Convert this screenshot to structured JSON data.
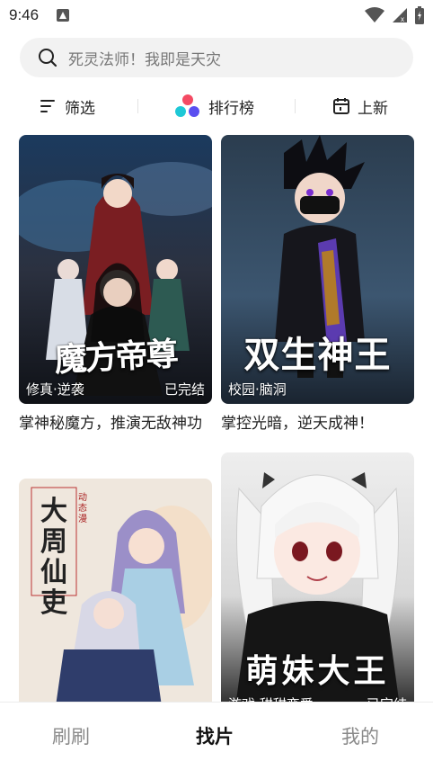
{
  "status_bar": {
    "time": "9:46"
  },
  "search": {
    "placeholder": "死灵法师！我即是天灾"
  },
  "filters": {
    "filter_label": "筛选",
    "ranking_label": "排行榜",
    "new_label": "上新"
  },
  "cards": [
    {
      "cover_title": "魔方帝尊",
      "tags": "修真·逆袭",
      "status": "已完结",
      "description": "掌神秘魔方，推演无敌神功"
    },
    {
      "cover_title": "双生神王",
      "tags": "校园·脑洞",
      "status": "",
      "description": "掌控光暗，逆天成神！"
    },
    {
      "cover_title": "大周仙吏",
      "cover_badge": "动态漫",
      "tags": "",
      "status": "",
      "description": ""
    },
    {
      "cover_title": "萌妹大王",
      "tags": "游戏·甜甜恋爱",
      "status": "已完结",
      "description": ""
    }
  ],
  "bottom_nav": {
    "items": [
      "刷刷",
      "找片",
      "我的"
    ],
    "active": "找片"
  },
  "colors": {
    "accent_red": "#f44a63",
    "accent_blue": "#5a4ff0",
    "accent_cyan": "#1ec8d6",
    "search_bg": "#f2f2f2",
    "nav_inactive": "#8a8a8a"
  }
}
